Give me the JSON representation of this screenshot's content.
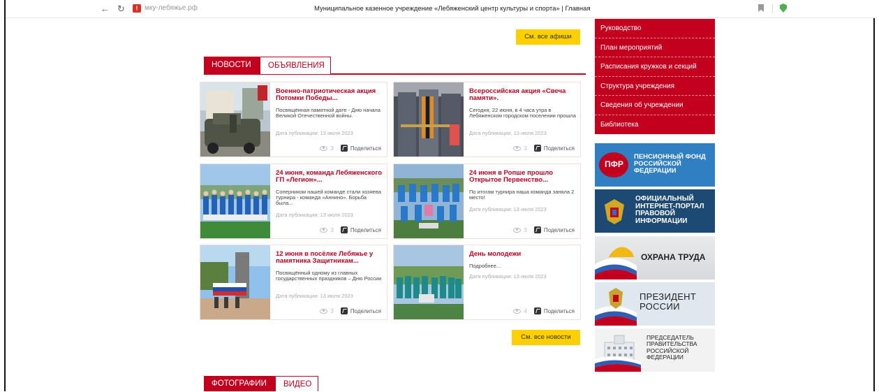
{
  "browser": {
    "url": "мку-лебяжье.рф",
    "page_title": "Муниципальное казенное учреждение «Лебяженский центр культуры и спорта» | Главная"
  },
  "afisha_button": "См. все афиши",
  "news_button": "См. все новости",
  "tabs": {
    "news": "НОВОСТИ",
    "announcements": "ОБЪЯВЛЕНИЯ"
  },
  "bottom_tabs": {
    "photos": "ФОТОГРАФИИ",
    "video": "ВИДЕО"
  },
  "share_label": "Поделиться",
  "news": [
    {
      "title": "Военно-патриотическая акция Потомки Победы...",
      "excerpt": "Посвящённая памятной дате - Дню начала Великой Отечественной войны.",
      "date": "Дата публикации: 13 июля 2023",
      "views": "3"
    },
    {
      "title": "Всероссийская акция «Свеча памяти».",
      "excerpt": "Сегодня, 22 июня, в 4 часа утра в Лебяженском городском поселении прошла",
      "date": "Дата публикации: 13 июля 2023",
      "views": "3"
    },
    {
      "title": "24 июня, команда Лебяженского ГП «Легион»...",
      "excerpt": "Соперником нашей команде стали хозяева турнира - команда «Аннино». Борьба была...",
      "date": "Дата публикации: 13 июля 2023",
      "views": "3"
    },
    {
      "title": "24 июня в Ропше прошло Открытое Первенство...",
      "excerpt": "По итогам турнира наша команда заняла 2 место!",
      "date": "Дата публикации: 13 июля 2023",
      "views": "3"
    },
    {
      "title": "12 июня в посёлке Лебяжье у памятника Защитникам...",
      "excerpt": "Посвящённый одному из главных государственных праздников – Дню России",
      "date": "Дата публикации: 13 июля 2023",
      "views": "3"
    },
    {
      "title": "День молодежи",
      "excerpt": "Подробнее...",
      "date": "Дата публикации: 13 июля 2023",
      "views": "4"
    }
  ],
  "menu": [
    "Руководство",
    "План мероприятий",
    "Расписания кружков и секций",
    "Структура учреждения",
    "Сведения об учреждении",
    "Библиотека"
  ],
  "banners": {
    "pension": "ПЕНСИОННЫЙ ФОНД РОССИЙСКОЙ ФЕДЕРАЦИИ",
    "pension_logo": "ПФР",
    "pravo": "ОФИЦИАЛЬНЫЙ ИНТЕРНЕТ-ПОРТАЛ ПРАВОВОЙ ИНФОРМАЦИИ",
    "ohrana": "ОХРАНА ТРУДА",
    "president": "ПРЕЗИДЕНТ РОССИИ",
    "government": "ПРЕДСЕДАТЕЛЬ ПРАВИТЕЛЬСТВА РОССИЙСКОЙ ФЕДЕРАЦИИ"
  },
  "colors": {
    "brand_red": "#c4001f",
    "button_yellow": "#ffd000"
  }
}
